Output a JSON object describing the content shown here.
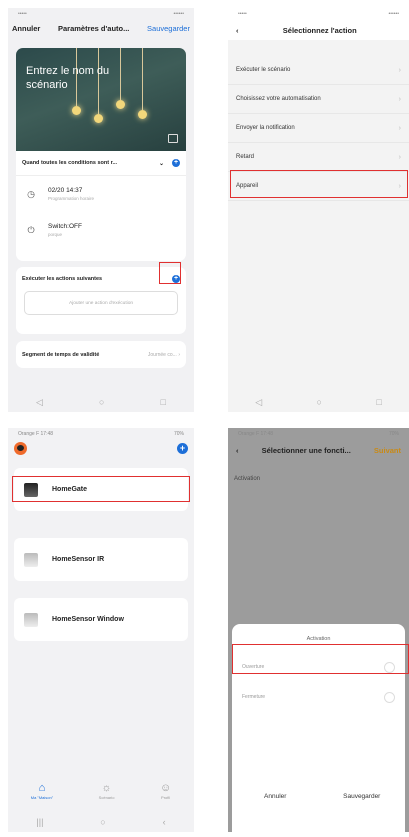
{
  "screen1": {
    "status_left": "•••••",
    "status_right": "••••••",
    "cancel": "Annuler",
    "title": "Paramètres d'auto...",
    "save": "Sauvegarder",
    "hero_title": "Entrez le nom du scénario",
    "conditions_header": "Quand toutes les conditions sont r...",
    "cond1_value": "02/20 14:37",
    "cond1_sub": "Programmation horaire",
    "cond2_value": "Switch:OFF",
    "cond2_sub": "porque",
    "actions_header": "Exécuter les actions suivantes",
    "add_action": "Ajouter une action d'exécution",
    "segment_label": "Segment de temps de validité",
    "segment_value": "Journée co..."
  },
  "screen2": {
    "title": "Sélectionnez l'action",
    "items": [
      "Exécuter le scénario",
      "Choisissez votre automatisation",
      "Envoyer la notification",
      "Retard",
      "Appareil"
    ]
  },
  "screen3": {
    "status": "Orange F 17:48",
    "status_right": "70%",
    "devices": [
      "HomeGate",
      "HomeSensor IR",
      "HomeSensor Window"
    ],
    "tabs": [
      "Ma \"Maison\"",
      "Scénario",
      "Profil"
    ]
  },
  "screen4": {
    "title": "Sélectionner une foncti...",
    "next": "Suivant",
    "activation_label": "Activation",
    "sheet_title": "Activation",
    "opt1": "Ouverture",
    "opt2": "Fermeture",
    "cancel": "Annuler",
    "save": "Sauvegarder"
  },
  "colors": {
    "accent": "#1d6fd8",
    "highlight": "#e03030",
    "orange": "#c98a15"
  }
}
